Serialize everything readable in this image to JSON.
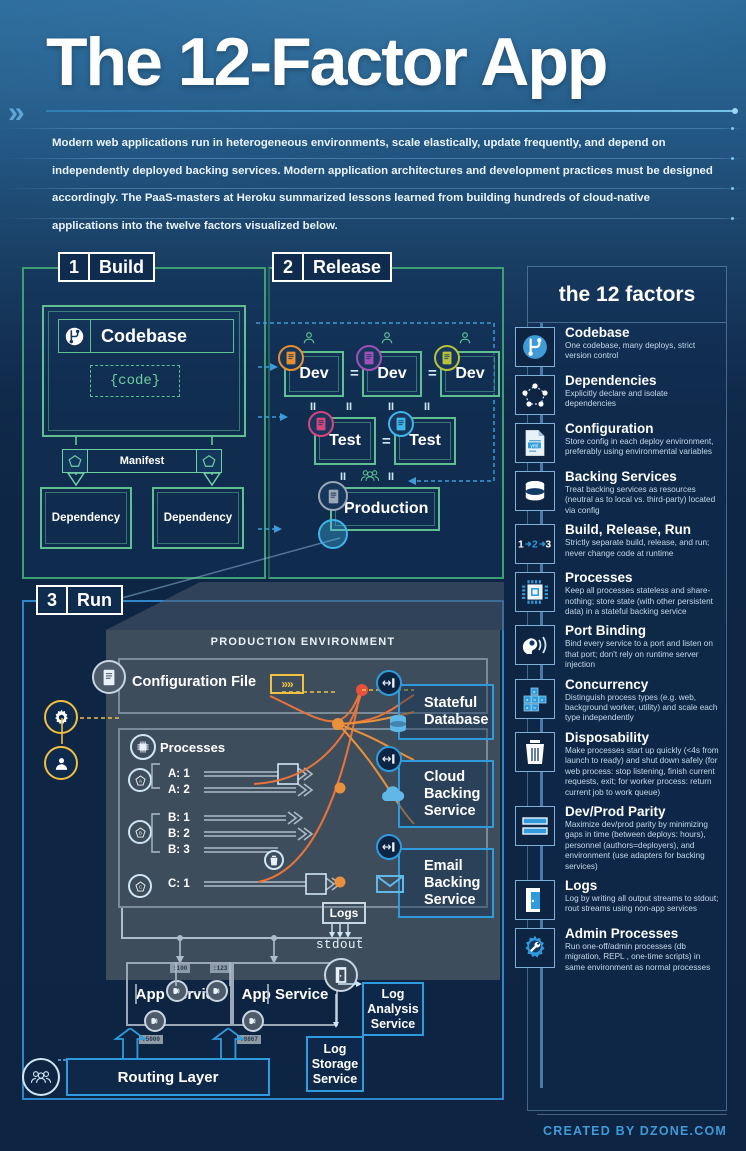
{
  "header": {
    "title": "The 12-Factor App",
    "chevron": "»",
    "subtitle": "Modern web applications run in heterogeneous environments, scale elastically, update frequently, and depend on independently deployed backing services. Modern application architectures and development practices must be designed accordingly. The PaaS-masters at Heroku summarized lessons learned from building hundreds of cloud-native applications into the twelve factors visualized below."
  },
  "colors": {
    "green": "#5fbf93",
    "blue": "#2f9bdc",
    "yellow": "#f0c042",
    "orange": "#e8743b",
    "gray": "#9aa8b6",
    "bg_dark": "#0d2442",
    "accent_credit": "#3f9bd8"
  },
  "build": {
    "number": "1",
    "label": "Build",
    "codebase_label": "Codebase",
    "codebase_icon": "codebase-branch-icon",
    "code_token": "{code}",
    "manifest_label": "Manifest",
    "manifest_icon": "pentagon-refresh-icon",
    "dependencies": [
      "Dependency",
      "Dependency"
    ]
  },
  "release": {
    "number": "2",
    "label": "Release",
    "dev_boxes": [
      {
        "label": "Dev",
        "badge_color": "#e8902f"
      },
      {
        "label": "Dev",
        "badge_color": "#a050b8"
      },
      {
        "label": "Dev",
        "badge_color": "#b8c33c"
      }
    ],
    "test_boxes": [
      {
        "label": "Test",
        "badge_color": "#d8447e"
      },
      {
        "label": "Test",
        "badge_color": "#3fb4e8"
      }
    ],
    "production": {
      "label": "Production",
      "badge_color": "#9aa8b6"
    },
    "equals": "=",
    "parallel": "II",
    "person_icon": "person-icon",
    "team_icon": "team-icon",
    "file_icon": "document-icon"
  },
  "run": {
    "number": "3",
    "label": "Run",
    "prod_env_title": "PRODUCTION ENVIRONMENT",
    "config_file_label": "Configuration File",
    "config_arrow_glyph": "»»",
    "config_icon": "gear-config-icon",
    "admin_icon": "admin-user-icon",
    "doc_icon": "document-icon",
    "processes_label": "Processes",
    "processes_icon": "chip-icon",
    "process_rows": [
      {
        "label": "A: 1",
        "has_box": true,
        "has_trash": false
      },
      {
        "label": "A: 2",
        "has_box": false,
        "has_trash": false
      },
      {
        "label": "B: 1",
        "has_box": false,
        "has_trash": false
      },
      {
        "label": "B: 2",
        "has_box": false,
        "has_trash": false
      },
      {
        "label": "B: 3",
        "has_box": false,
        "has_trash": true
      },
      {
        "label": "C: 1",
        "has_box": true,
        "has_trash": false
      }
    ],
    "process_group_icons": [
      "process-a-icon",
      "process-b-icon",
      "process-c-icon"
    ],
    "app_services": [
      {
        "label": "App Service",
        "internal_port": ":100",
        "external_port": ":5000"
      },
      {
        "label": "App Service",
        "internal_port": ":123",
        "external_port": ":8867"
      }
    ],
    "port_icon": "port-listen-icon",
    "logs_label": "Logs",
    "stdout_label": "stdout",
    "log_door_icon": "door-icon",
    "backing_services": [
      {
        "label": "Stateful Database",
        "icon": "database-icon"
      },
      {
        "label": "Cloud Backing Service",
        "icon": "cloud-icon"
      },
      {
        "label": "Email Backing Service",
        "icon": "envelope-icon"
      }
    ],
    "port_binding_icon": "port-binding-icon",
    "log_services": [
      {
        "label": "Log Analysis Service"
      },
      {
        "label": "Log Storage Service"
      }
    ],
    "routing_layer_label": "Routing Layer",
    "routing_icon": "users-group-icon"
  },
  "factors": {
    "heading": "the 12 factors",
    "items": [
      {
        "title": "Codebase",
        "desc": "One codebase, many deploys, strict version control",
        "icon": "codebase-branch-icon"
      },
      {
        "title": "Dependencies",
        "desc": "Explicitly declare and isolate dependencies",
        "icon": "dependency-graph-icon"
      },
      {
        "title": "Configuration",
        "desc": "Store config in each deploy environment, preferably using environmental variables",
        "icon": "yaml-file-icon"
      },
      {
        "title": "Backing Services",
        "desc": "Treat backing services as resources (neutral as to local vs. third-party) located via config",
        "icon": "database-icon"
      },
      {
        "title": "Build, Release, Run",
        "desc": "Strictly separate build, release, and run; never change code at runtime",
        "icon": "one-two-three-icon"
      },
      {
        "title": "Processes",
        "desc": "Keep all processes stateless and share-nothing; store state (with other persistent data) in a stateful backing service",
        "icon": "chip-icon"
      },
      {
        "title": "Port Binding",
        "desc": "Bind every service to a port and listen on that port; don't rely on runtime server injection",
        "icon": "ear-listen-icon"
      },
      {
        "title": "Concurrency",
        "desc": "Distinguish process types (e.g. web, background worker, utility) and scale each type independently",
        "icon": "blocks-scale-icon"
      },
      {
        "title": "Disposability",
        "desc": "Make processes start up quickly (<4s from launch to ready) and shut down safely (for web process: stop listening, finish current requests, exit; for worker process: return current job to work queue)",
        "icon": "trash-icon"
      },
      {
        "title": "Dev/Prod Parity",
        "desc": "Maximize dev/prod parity by minimizing gaps in time (between deploys: hours), personnel (authors=deployers), and environment (use adapters for backing services)",
        "icon": "equal-bars-icon"
      },
      {
        "title": "Logs",
        "desc": "Log by writing all output streams to stdout; rout streams using non-app services",
        "icon": "door-icon"
      },
      {
        "title": "Admin Processes",
        "desc": "Run one-off/admin processes (db migration, REPL , one-time scripts) in same environment as normal processes",
        "icon": "gear-wrench-icon"
      }
    ]
  },
  "footer": {
    "credit": "CREATED BY DZONE.COM"
  }
}
